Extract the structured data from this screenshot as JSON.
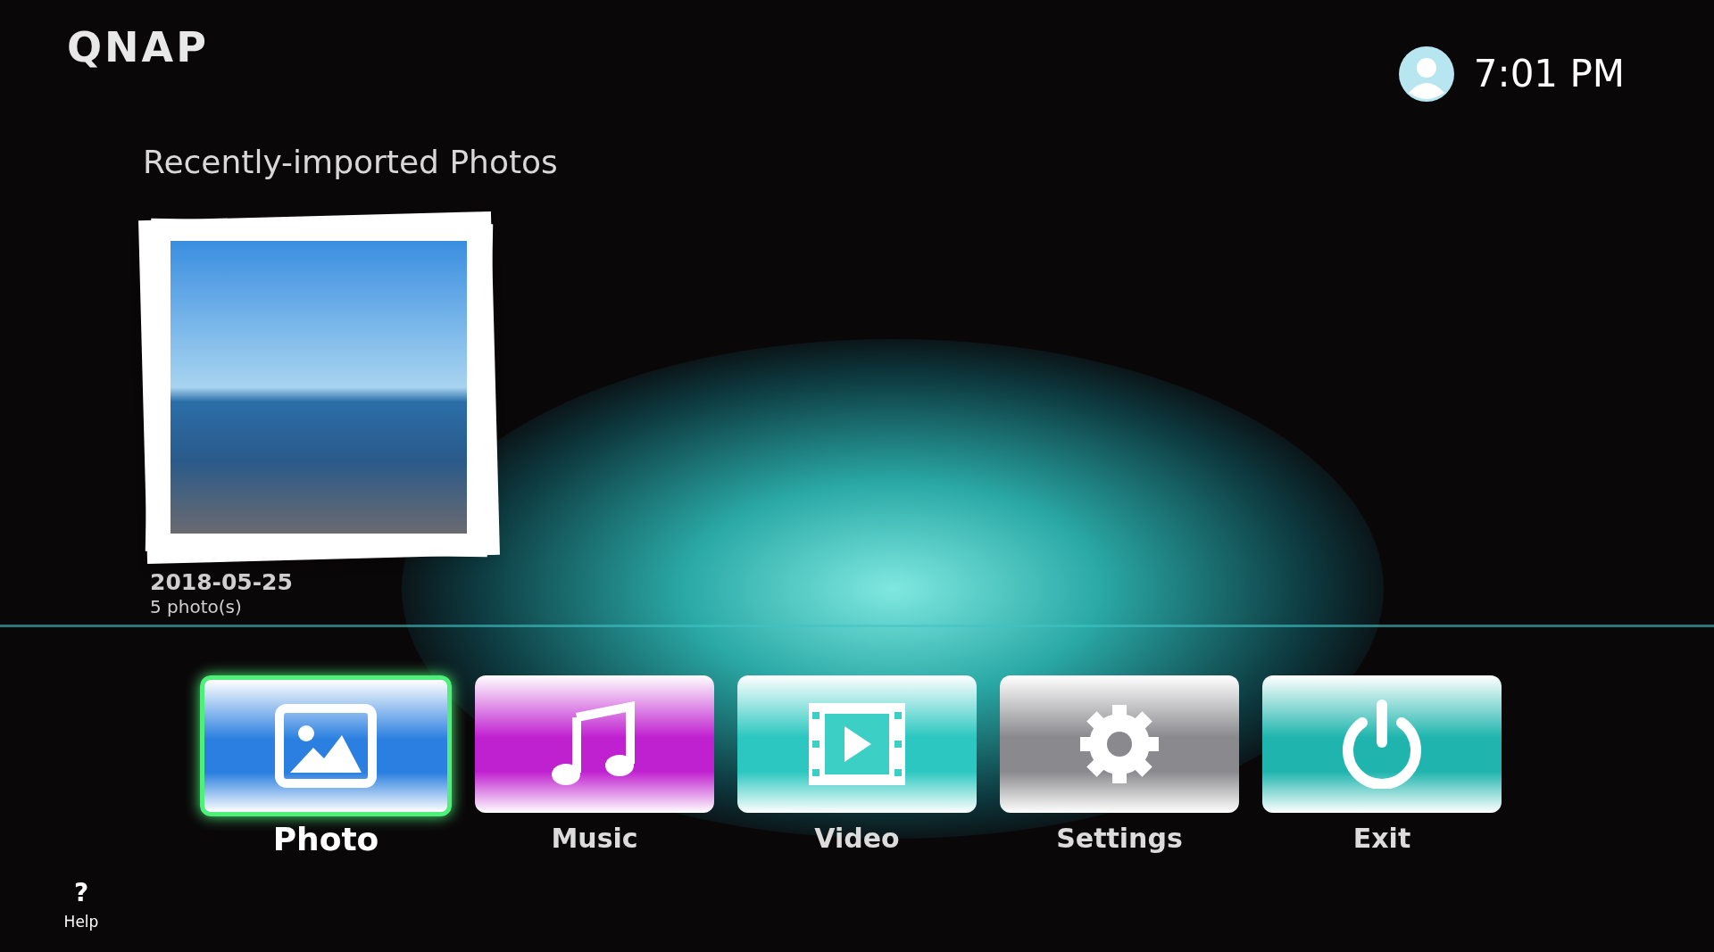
{
  "logo": "QNAP",
  "clock": {
    "time": "7:01 PM"
  },
  "recent": {
    "title": "Recently-imported Photos",
    "album": {
      "date": "2018-05-25",
      "count": "5 photo(s)"
    }
  },
  "menu": [
    {
      "label": "Photo",
      "kind": "photo",
      "color": "#2a7fe0",
      "selected": true
    },
    {
      "label": "Music",
      "kind": "music",
      "color": "#c021d0",
      "selected": false
    },
    {
      "label": "Video",
      "kind": "video",
      "color": "#2cc7c0",
      "selected": false
    },
    {
      "label": "Settings",
      "kind": "settings",
      "color": "#8a8a8e",
      "selected": false
    },
    {
      "label": "Exit",
      "kind": "exit",
      "color": "#1fb5ae",
      "selected": false
    }
  ],
  "help": {
    "icon": "?",
    "label": "Help"
  }
}
